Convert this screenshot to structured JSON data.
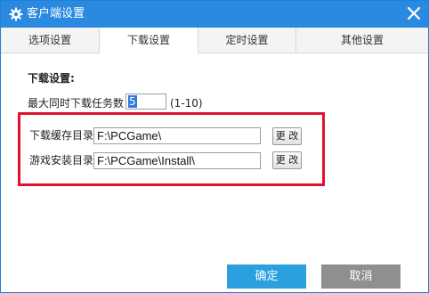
{
  "window": {
    "title": "客户端设置"
  },
  "tabs": [
    {
      "label": "选项设置",
      "active": false
    },
    {
      "label": "下载设置",
      "active": true
    },
    {
      "label": "定时设置",
      "active": false
    },
    {
      "label": "其他设置",
      "active": false
    }
  ],
  "download": {
    "section_title": "下载设置:",
    "max_tasks_label": "最大同时下载任务数：",
    "max_tasks_value": "5",
    "max_tasks_range": "(1-10)",
    "cache_dir_label": "下载缓存目录：",
    "cache_dir_value": "F:\\PCGame\\",
    "install_dir_label": "游戏安装目录：",
    "install_dir_value": "F:\\PCGame\\Install\\",
    "change_label": "更 改"
  },
  "buttons": {
    "ok": "确定",
    "cancel": "取消"
  },
  "colors": {
    "titlebar": "#2a8ae0",
    "highlight_box": "#e2122c",
    "ok_button": "#2aa0df",
    "cancel_button": "#8f8f8f"
  },
  "icons": {
    "title": "gear-icon",
    "close": "close-icon"
  }
}
